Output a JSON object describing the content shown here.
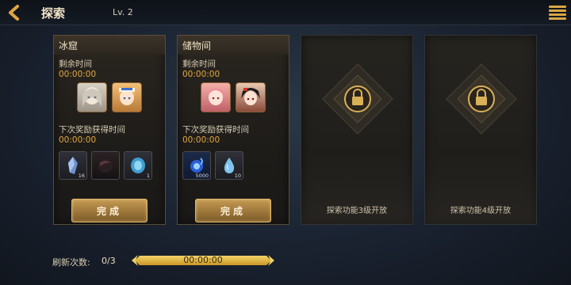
{
  "header": {
    "title": "探索",
    "level": "Lv. 2"
  },
  "cards": [
    {
      "name": "冰窟",
      "remaining_label": "剩余时间",
      "remaining_time": "00:00:00",
      "next_reward_label": "下次奖励获得时间",
      "next_reward_time": "00:00:00",
      "rewards": [
        {
          "icon": "ice-crystal-icon",
          "count": "16"
        },
        {
          "icon": "dark-orb-icon",
          "count": ""
        },
        {
          "icon": "blue-gem-icon",
          "count": "1"
        }
      ],
      "button": "完成"
    },
    {
      "name": "储物间",
      "remaining_label": "剩余时间",
      "remaining_time": "00:00:00",
      "next_reward_label": "下次奖励获得时间",
      "next_reward_time": "00:00:00",
      "rewards": [
        {
          "icon": "blue-fire-orb-icon",
          "count": "5000"
        },
        {
          "icon": "water-drop-icon",
          "count": "10"
        }
      ],
      "button": "完成"
    },
    {
      "locked_text": "探索功能3级开放"
    },
    {
      "locked_text": "探索功能4级开放"
    }
  ],
  "footer": {
    "refresh_label": "刷新次数:",
    "refresh_count": "0/3",
    "timer": "00:00:00"
  },
  "colors": {
    "accent_gold": "#e0a640",
    "button_gold": "#c59a52"
  }
}
